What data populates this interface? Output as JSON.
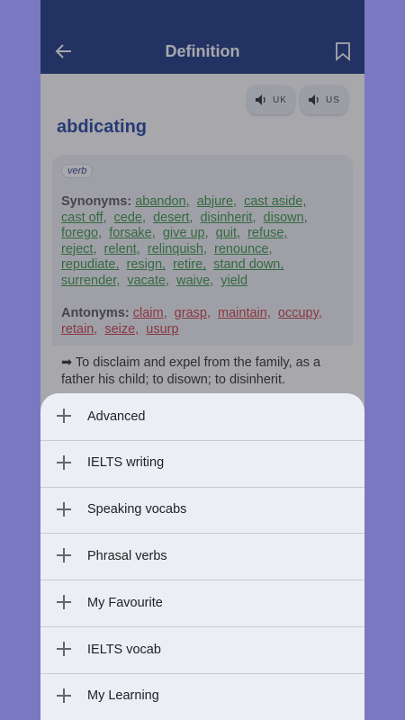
{
  "app": {
    "title": "Definition",
    "word": "abdicating",
    "part_of_speech": "verb",
    "pronunciation": {
      "uk_label": "UK",
      "us_label": "US"
    }
  },
  "synonyms_label": "Synonyms:",
  "synonyms": [
    "abandon,",
    "abjure,",
    "cast aside,",
    "cast off,",
    "cede,",
    "desert,",
    "disinherit,",
    "disown,",
    "forego,",
    "forsake,",
    "give up,",
    "quit,",
    "refuse,",
    "reject,",
    "relent,",
    "relinquish,",
    "renounce,",
    "repudiate,",
    "resign,",
    "retire,",
    "stand down,",
    "surrender,",
    "vacate,",
    "waive,",
    "yield"
  ],
  "antonyms_label": "Antonyms:",
  "antonyms": [
    "claim,",
    "grasp,",
    "maintain,",
    "occupy,",
    "retain,",
    "seize,",
    "usurp"
  ],
  "definition": "➡ To disclaim and expel from the family, as a father his child; to disown; to disinherit.",
  "sheet": {
    "items": [
      {
        "label": "Advanced"
      },
      {
        "label": "IELTS writing"
      },
      {
        "label": "Speaking vocabs"
      },
      {
        "label": "Phrasal verbs"
      },
      {
        "label": "My Favourite"
      },
      {
        "label": "IELTS vocab"
      },
      {
        "label": "My Learning"
      }
    ]
  },
  "colors": {
    "primary": "#0e2a78",
    "outer_background": "#7a78c0",
    "synonym": "#2f8f3a",
    "antonym": "#c8323a",
    "word": "#173a9c"
  }
}
